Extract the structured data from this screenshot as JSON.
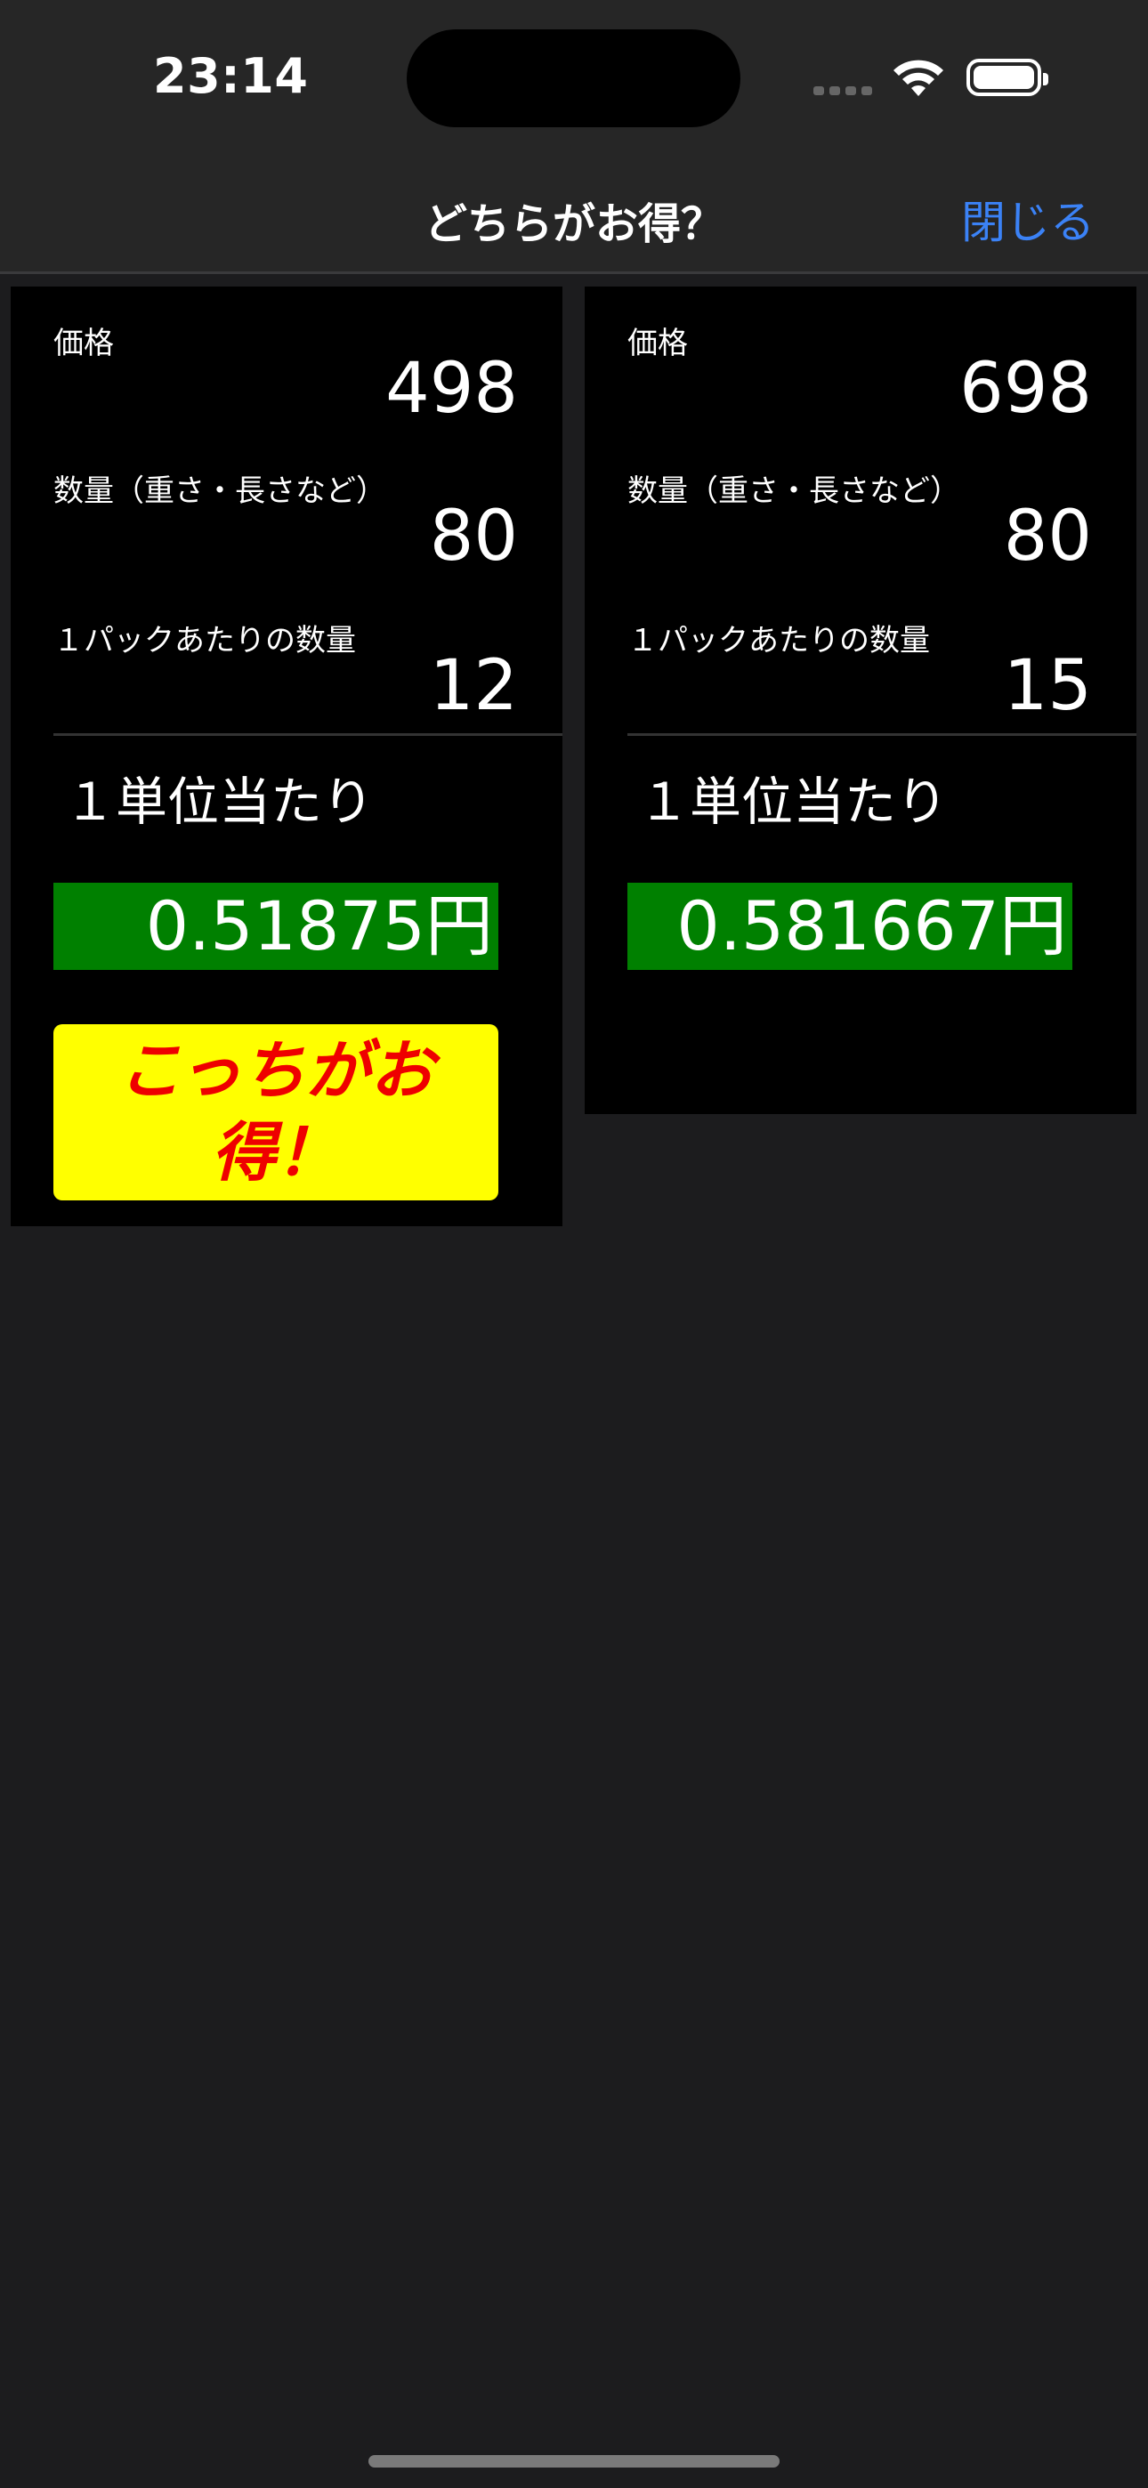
{
  "status_bar": {
    "time": "23:14"
  },
  "nav": {
    "title": "どちらがお得？",
    "close_label": "閉じる"
  },
  "left_card": {
    "price_label": "価格",
    "price": "498",
    "quantity_label": "数量（重さ・長さなど）",
    "quantity": "80",
    "per_pack_label": "１パックあたりの数量",
    "per_pack": "12",
    "unit_label": "１単位当たり",
    "unit_price": "0.51875円",
    "deal_badge": "こっちがお得！"
  },
  "right_card": {
    "price_label": "価格",
    "price": "698",
    "quantity_label": "数量（重さ・長さなど）",
    "quantity": "80",
    "per_pack_label": "１パックあたりの数量",
    "per_pack": "15",
    "unit_label": "１単位当たり",
    "unit_price": "0.581667円"
  },
  "colors": {
    "accent": "#3b82f6",
    "result_bg": "#008000",
    "badge_bg": "#ffff00",
    "badge_text": "#ee0000"
  },
  "icons": [
    "cellular-signal-icon",
    "wifi-icon",
    "battery-icon"
  ]
}
